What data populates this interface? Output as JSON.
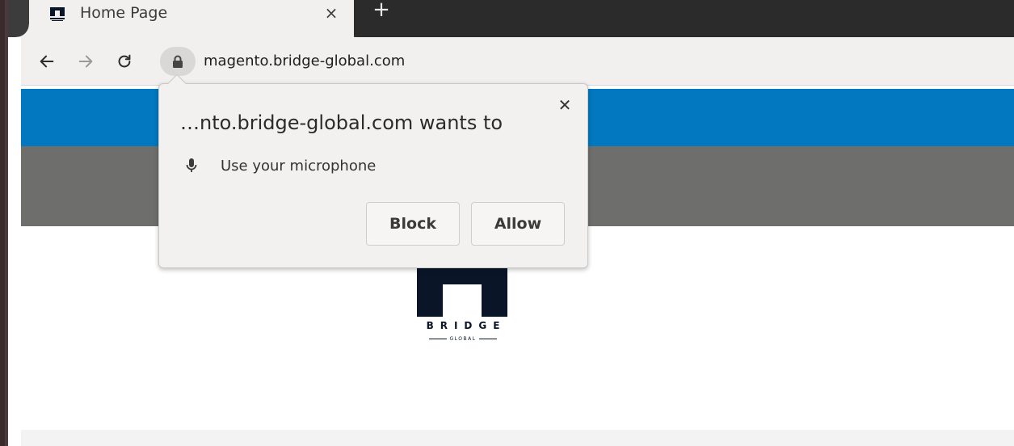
{
  "tab": {
    "title": "Home Page",
    "close_glyph": "×",
    "favicon": "bridge-favicon-icon"
  },
  "new_tab_glyph": "+",
  "toolbar": {
    "back_icon": "arrow-left-icon",
    "forward_icon": "arrow-right-icon",
    "reload_icon": "reload-icon",
    "url": "magento.bridge-global.com"
  },
  "permission_prompt": {
    "title": "…nto.bridge-global.com wants to",
    "close_glyph": "✕",
    "permission_label": "Use your microphone",
    "permission_icon": "microphone-icon",
    "block_label": "Block",
    "allow_label": "Allow"
  },
  "logo": {
    "brand_name": "BRIDGE",
    "sub_name": "GLOBAL"
  },
  "colors": {
    "blue_band": "#0178c0",
    "grey_band": "#6e6f6d",
    "logo_navy": "#0a1628"
  }
}
